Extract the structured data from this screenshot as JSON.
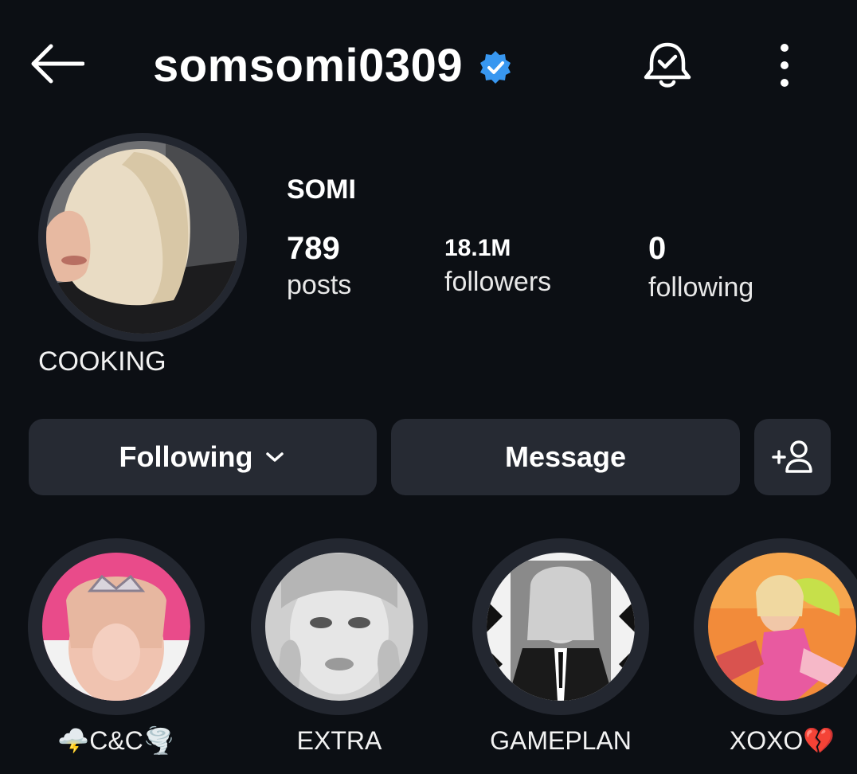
{
  "header": {
    "username": "somsomi0309",
    "verified": true,
    "icons": [
      "back-arrow-icon",
      "verified-badge-icon",
      "bell-icon",
      "more-vertical-icon"
    ]
  },
  "profile": {
    "avatar_note": "COOKING",
    "display_name": "SOMI",
    "stats": [
      {
        "value": "789",
        "label": "posts"
      },
      {
        "value": "18.1M",
        "label": "followers"
      },
      {
        "value": "0",
        "label": "following"
      }
    ]
  },
  "actions": {
    "following_label": "Following",
    "message_label": "Message",
    "add_icon": "add-person-icon"
  },
  "highlights": [
    {
      "label": "🌩️C&C🌪️"
    },
    {
      "label": "EXTRA"
    },
    {
      "label": "GAMEPLAN"
    },
    {
      "label": "XOXO💔"
    }
  ],
  "colors": {
    "background": "#0c0f14",
    "button": "#262a33",
    "verified": "#3897f0"
  }
}
